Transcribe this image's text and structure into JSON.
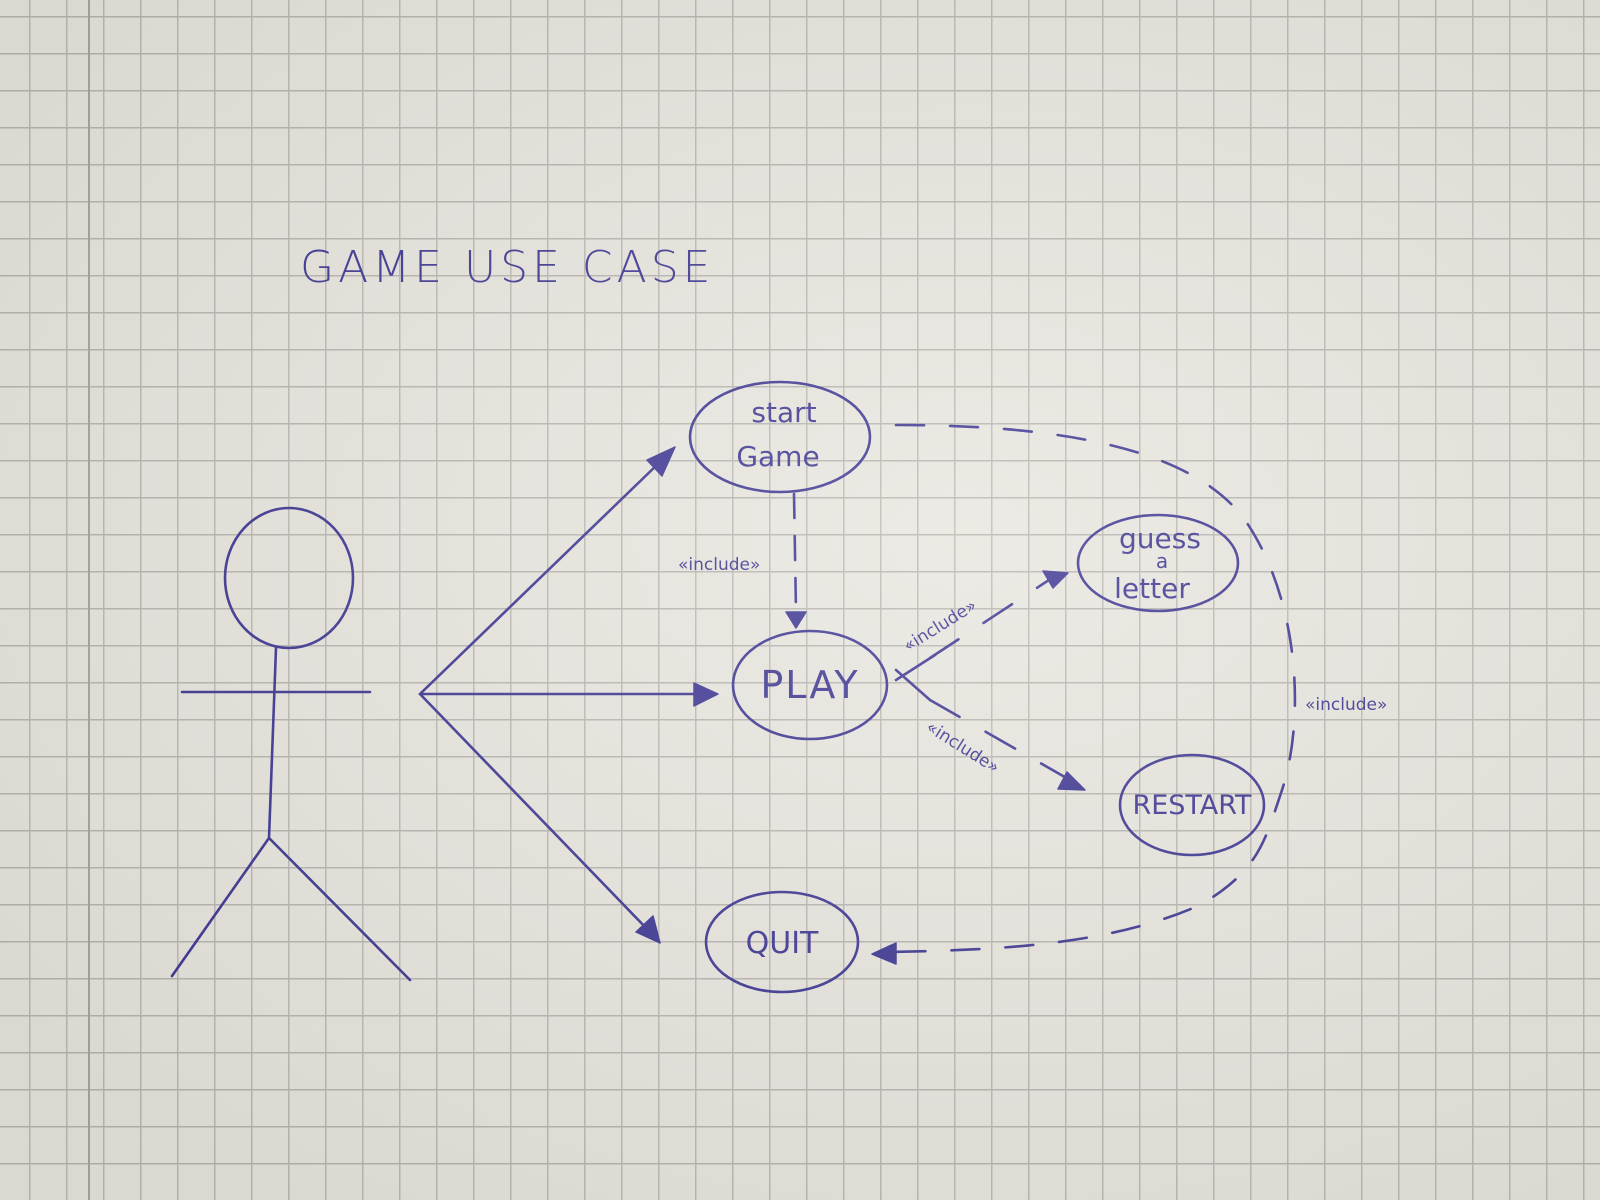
{
  "title": "GAME USE CASE",
  "use_cases": {
    "start_game": {
      "line1": "start",
      "line2": "Game"
    },
    "play": {
      "label": "PLAY"
    },
    "guess_letter": {
      "line1": "guess",
      "line2": "a",
      "line3": "letter"
    },
    "restart": {
      "label": "RESTART"
    },
    "quit": {
      "label": "QUIT"
    }
  },
  "relations": {
    "start_play": "«include»",
    "play_guess": "«include»",
    "play_restart": "«include»",
    "start_quit": "«include»"
  },
  "colors": {
    "ink": "#3f3893",
    "paper": "#e9e6df",
    "grid": "#b9b6b1"
  }
}
